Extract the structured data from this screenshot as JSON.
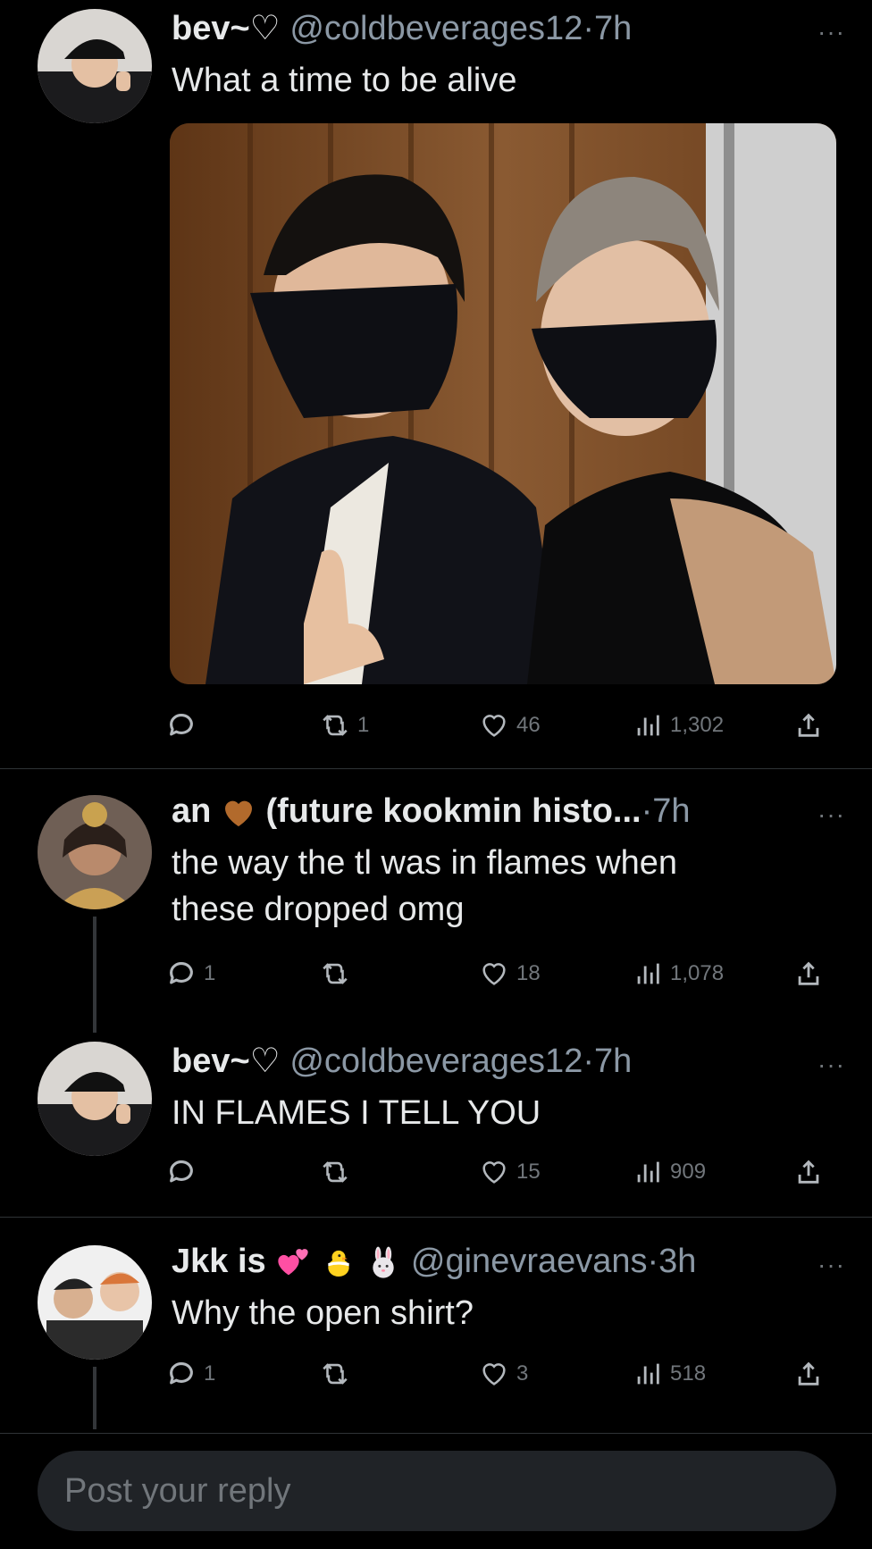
{
  "tweets": [
    {
      "name": "bev~",
      "name_suffix": "♡",
      "handle": "@coldbeverages12",
      "sep": "·",
      "time": "7h",
      "text": "What a time to be alive",
      "actions": {
        "replies": "",
        "retweets": "1",
        "likes": "46",
        "views": "1,302"
      }
    },
    {
      "name": "an",
      "name_suffix": "(future kookmin histo...",
      "sep": "·",
      "time": "7h",
      "text": "the way the tl was in flames when these dropped omg",
      "actions": {
        "replies": "1",
        "retweets": "",
        "likes": "18",
        "views": "1,078"
      }
    },
    {
      "name": "bev~",
      "name_suffix": "♡",
      "handle": "@coldbeverages12",
      "sep": "·",
      "time": "7h",
      "text": "IN FLAMES I TELL YOU",
      "actions": {
        "replies": "",
        "retweets": "",
        "likes": "15",
        "views": "909"
      }
    },
    {
      "name": "Jkk is",
      "handle": "@ginevraevans",
      "sep": "·",
      "time": "3h",
      "text": "Why the open shirt?",
      "actions": {
        "replies": "1",
        "retweets": "",
        "likes": "3",
        "views": "518"
      }
    }
  ],
  "more_label": "···",
  "reply_box": {
    "placeholder": "Post your reply"
  },
  "icons": {
    "reply": "reply-icon",
    "retweet": "retweet-icon",
    "like": "heart-icon",
    "views": "views-icon",
    "share": "share-icon"
  },
  "colors": {
    "background": "#000000",
    "text": "#e7e9ea",
    "muted": "#71767b",
    "divider": "#2f3336"
  }
}
